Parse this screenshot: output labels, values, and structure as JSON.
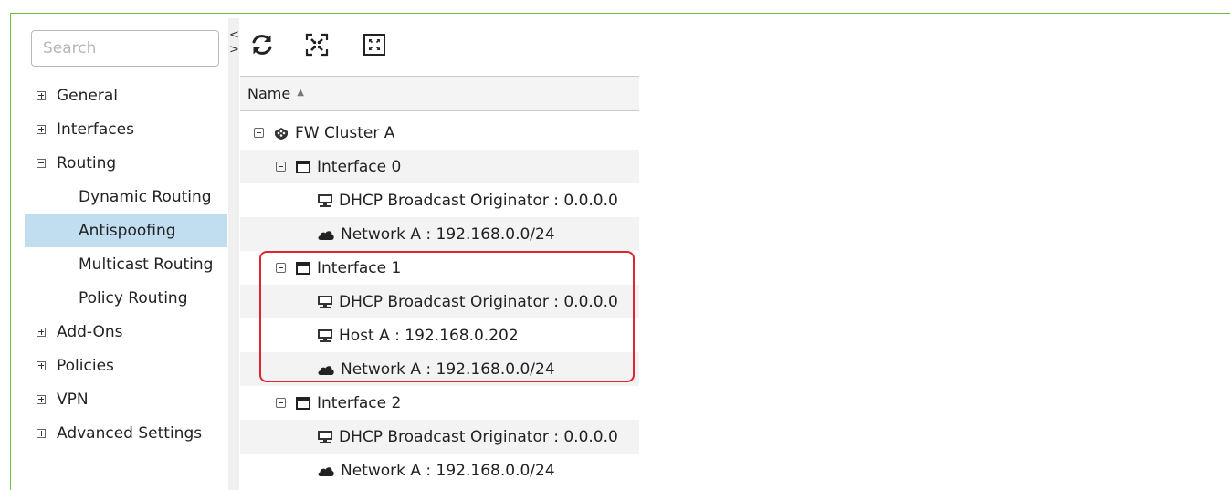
{
  "search": {
    "placeholder": "Search"
  },
  "collapse": {
    "left": "<",
    "right": ">"
  },
  "nav": {
    "items": [
      {
        "label": "General",
        "expander": "plus"
      },
      {
        "label": "Interfaces",
        "expander": "plus"
      },
      {
        "label": "Routing",
        "expander": "minus"
      },
      {
        "label": "Dynamic Routing"
      },
      {
        "label": "Antispoofing",
        "selected": true
      },
      {
        "label": "Multicast Routing"
      },
      {
        "label": "Policy Routing"
      },
      {
        "label": "Add-Ons",
        "expander": "plus"
      },
      {
        "label": "Policies",
        "expander": "plus"
      },
      {
        "label": "VPN",
        "expander": "plus"
      },
      {
        "label": "Advanced Settings",
        "expander": "plus"
      }
    ]
  },
  "toolbar": {
    "buttons": [
      {
        "icon": "refresh-icon"
      },
      {
        "icon": "collapse-all-icon"
      },
      {
        "icon": "expand-all-icon"
      }
    ]
  },
  "grid": {
    "header": {
      "name": "Name",
      "sort": "▲"
    },
    "rows": [
      {
        "label": "FW Cluster A",
        "icon": "firewall-cluster-icon",
        "level": 0,
        "expander": "minus"
      },
      {
        "label": "Interface 0",
        "icon": "interface-icon",
        "level": 1,
        "expander": "minus"
      },
      {
        "label": "DHCP Broadcast Originator : 0.0.0.0",
        "icon": "host-icon",
        "level": 2
      },
      {
        "label": "Network A : 192.168.0.0/24",
        "icon": "network-icon",
        "level": 2
      },
      {
        "label": "Interface 1",
        "icon": "interface-icon",
        "level": 1,
        "expander": "minus"
      },
      {
        "label": "DHCP Broadcast Originator : 0.0.0.0",
        "icon": "host-icon",
        "level": 2
      },
      {
        "label": "Host A : 192.168.0.202",
        "icon": "host-icon",
        "level": 2
      },
      {
        "label": "Network A : 192.168.0.0/24",
        "icon": "network-icon",
        "level": 2
      },
      {
        "label": "Interface 2",
        "icon": "interface-icon",
        "level": 1,
        "expander": "minus"
      },
      {
        "label": "DHCP Broadcast Originator : 0.0.0.0",
        "icon": "host-icon",
        "level": 2
      },
      {
        "label": "Network A : 192.168.0.0/24",
        "icon": "network-icon",
        "level": 2
      }
    ]
  },
  "colors": {
    "frame": "#6fbf3f",
    "selected": "#c1def0",
    "highlight": "#e0252b"
  }
}
